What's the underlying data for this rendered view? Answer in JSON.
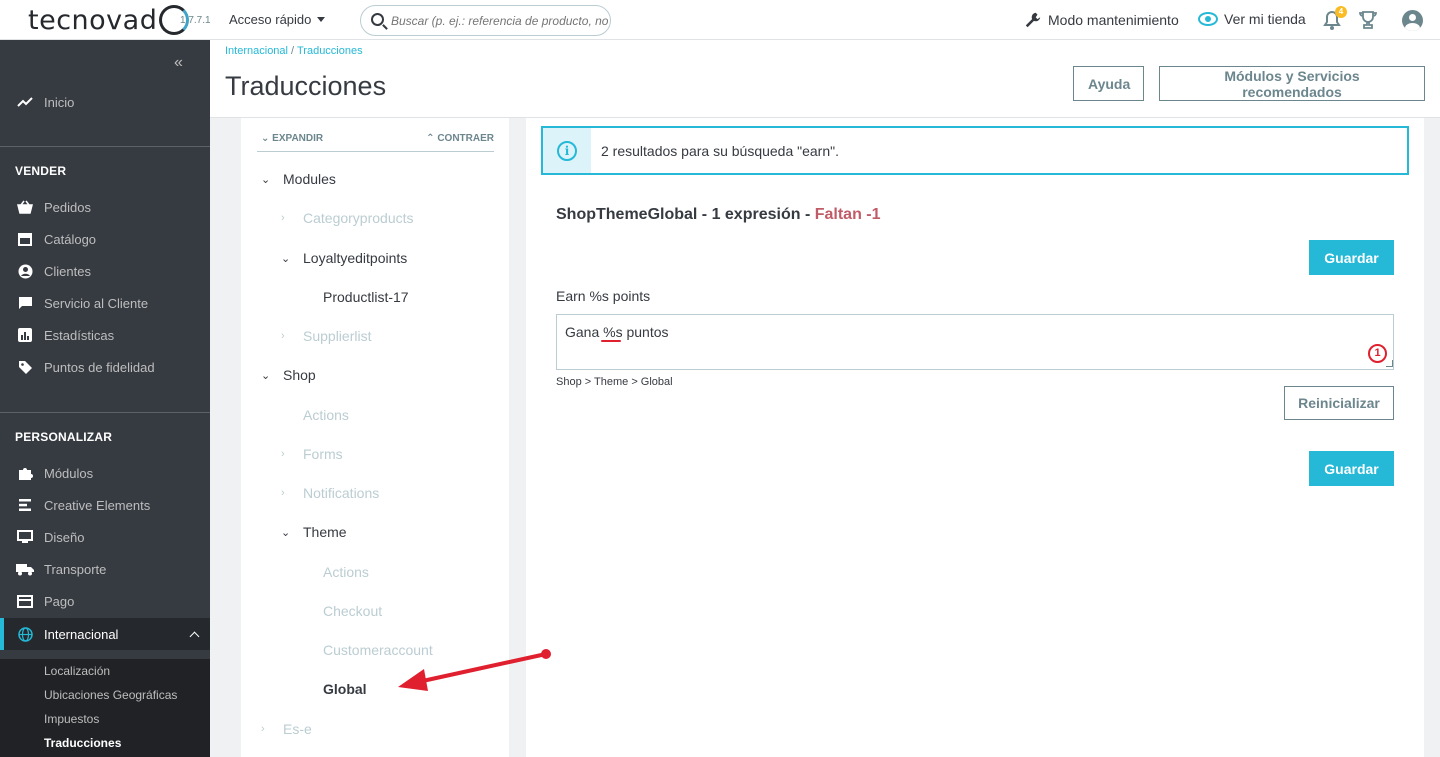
{
  "header": {
    "logo_text": "tecnovad",
    "version": "1.7.7.1",
    "quick_access": "Acceso rápido",
    "search_placeholder": "Buscar (p. ej.: referencia de producto, no",
    "maintenance": "Modo mantenimiento",
    "view_store": "Ver mi tienda",
    "notifications_count": "4"
  },
  "sidebar": {
    "home": "Inicio",
    "sections": [
      {
        "title": "VENDER",
        "items": [
          "Pedidos",
          "Catálogo",
          "Clientes",
          "Servicio al Cliente",
          "Estadísticas",
          "Puntos de fidelidad"
        ]
      },
      {
        "title": "PERSONALIZAR",
        "items": [
          "Módulos",
          "Creative Elements",
          "Diseño",
          "Transporte",
          "Pago",
          "Internacional"
        ]
      }
    ],
    "sub_items": [
      "Localización",
      "Ubicaciones Geográficas",
      "Impuestos",
      "Traducciones"
    ]
  },
  "page": {
    "breadcrumb": [
      "Internacional",
      "Traducciones"
    ],
    "title": "Traducciones",
    "help_button": "Ayuda",
    "modules_button": "Módulos y Servicios recomendados"
  },
  "tree": {
    "expand": "EXPANDIR",
    "collapse": "CONTRAER",
    "nodes": [
      "Modules",
      "Categoryproducts",
      "Loyaltyeditpoints",
      "Productlist-17",
      "Supplierlist",
      "Shop",
      "Actions",
      "Forms",
      "Notifications",
      "Theme",
      "Actions",
      "Checkout",
      "Customeraccount",
      "Global",
      "Es-e"
    ]
  },
  "main": {
    "alert": "2 resultados para su búsqueda \"earn\".",
    "section_title": "ShopThemeGlobal - 1 expresión - ",
    "missing": "Faltan -1",
    "save": "Guardar",
    "source_label": "Earn %s points",
    "translation_value": "Gana %s puntos",
    "counter": "1",
    "path": "Shop > Theme > Global",
    "reset": "Reinicializar"
  },
  "colors": {
    "accent": "#25b9d7",
    "sidebar_bg": "#363a41",
    "missing": "#c05c67",
    "annotation_arrow": "#e0202f"
  }
}
